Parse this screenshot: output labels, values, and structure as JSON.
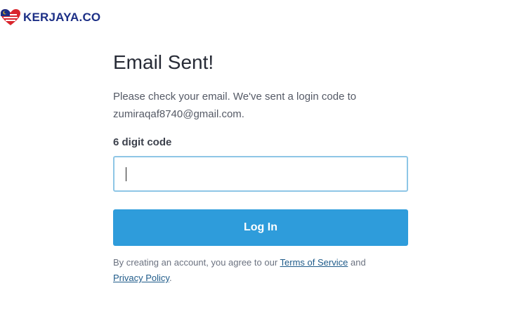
{
  "brand": {
    "name": "KERJAYA.CO",
    "colors": {
      "navy": "#1c2f86",
      "red": "#d9262d",
      "yellow": "#f5c518",
      "accent": "#2e9cdb"
    }
  },
  "main": {
    "title": "Email Sent!",
    "message_line1": "Please check your email. We've sent a login code to",
    "message_line2": "zumiraqaf8740@gmail.com.",
    "code_label": "6 digit code",
    "code_value": "",
    "login_button": "Log In",
    "legal": {
      "prefix": "By creating an account, you agree to our",
      "terms_link": "Terms of Service",
      "and": "and",
      "privacy_link": "Privacy Policy",
      "suffix": "."
    }
  }
}
